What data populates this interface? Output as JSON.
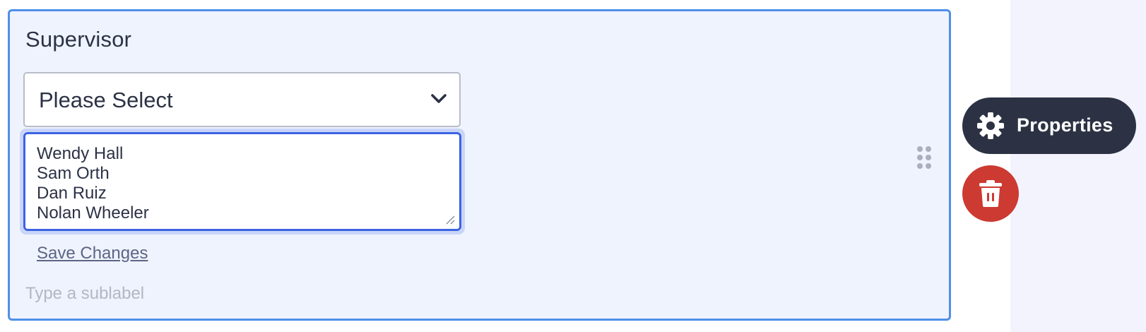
{
  "field": {
    "label": "Supervisor",
    "select": {
      "selected": "Please Select",
      "icon": "chevron-down-icon"
    },
    "options_editor": {
      "options": [
        "Wendy Hall",
        "Sam Orth",
        "Dan Ruiz",
        "Nolan Wheeler"
      ]
    },
    "save_label": "Save Changes",
    "sublabel_placeholder": "Type a sublabel"
  },
  "toolbar": {
    "properties_label": "Properties",
    "properties_icon": "gear-icon",
    "delete_icon": "trash-icon"
  },
  "colors": {
    "card_bg": "#eff3fd",
    "card_border": "#4f8fe8",
    "textarea_border": "#3c63e3",
    "properties_bg": "#2c3244",
    "delete_bg": "#cc3a31"
  }
}
